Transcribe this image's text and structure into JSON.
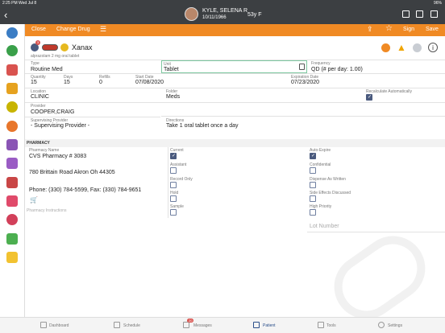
{
  "status": {
    "time": "2:25 PM",
    "date": "Wed Jul 8",
    "battery": "96%"
  },
  "patient": {
    "name": "KYLE, SELENA R",
    "dob": "10/11/1966",
    "age_sex": "53y F"
  },
  "toolbar": {
    "close": "Close",
    "change_drug": "Change Drug",
    "sign": "Sign",
    "save": "Save"
  },
  "drug": {
    "name": "Xanax",
    "generic": "alprazolam 2 mg oral tablet",
    "badge_count": "3"
  },
  "fields": {
    "type_label": "Type",
    "type": "Routine Med",
    "unit_label": "Unit",
    "unit": "Tablet",
    "frequency_label": "Frequency",
    "frequency": "QD (# per day: 1.00)",
    "quantity_label": "Quantity",
    "quantity": "15",
    "days_label": "Days",
    "days": "15",
    "refills_label": "Refills",
    "refills": "0",
    "start_label": "Start Date",
    "start": "07/08/2020",
    "expiration_label": "Expiration Date",
    "expiration": "07/23/2020",
    "location_label": "Location",
    "location": "CLINIC",
    "folder_label": "Folder",
    "folder": "Meds",
    "recalc_label": "Recalculate Automatically",
    "provider_label": "Provider",
    "provider": "COOPER,CRAIG",
    "supervising_label": "Supervising Provider",
    "supervising": "- Supervising Provider -",
    "directions_label": "Directions",
    "directions": "Take 1 oral tablet once a day"
  },
  "pharmacy": {
    "section": "PHARMACY",
    "name_label": "Pharmacy Name",
    "name": "CVS Pharmacy # 3083",
    "address": "780 Brittain Road Akron Oh 44305",
    "phone": "Phone: (330) 784-5599, Fax: (330) 784-9651",
    "instructions_placeholder": "Pharmacy Instructions",
    "lot_placeholder": "Lot Number"
  },
  "checks": {
    "current": "Current",
    "assistant": "Assistant",
    "record_only": "Record Only",
    "hold": "Hold",
    "sample": "Sample",
    "auto_expire": "Auto-Expire",
    "confidential": "Confidential",
    "dispense": "Dispense As Written",
    "side_effects": "Side Effects Discussed",
    "high_priority": "High Priority"
  },
  "nav": {
    "dashboard": "Dashboard",
    "schedule": "Schedule",
    "messages": "Messages",
    "messages_badge": "20",
    "patient": "Patient",
    "tools": "Tools",
    "settings": "Settings"
  },
  "colors": {
    "accent": "#f08a24",
    "header": "#3c3f42",
    "active": "#2b4f8a"
  }
}
